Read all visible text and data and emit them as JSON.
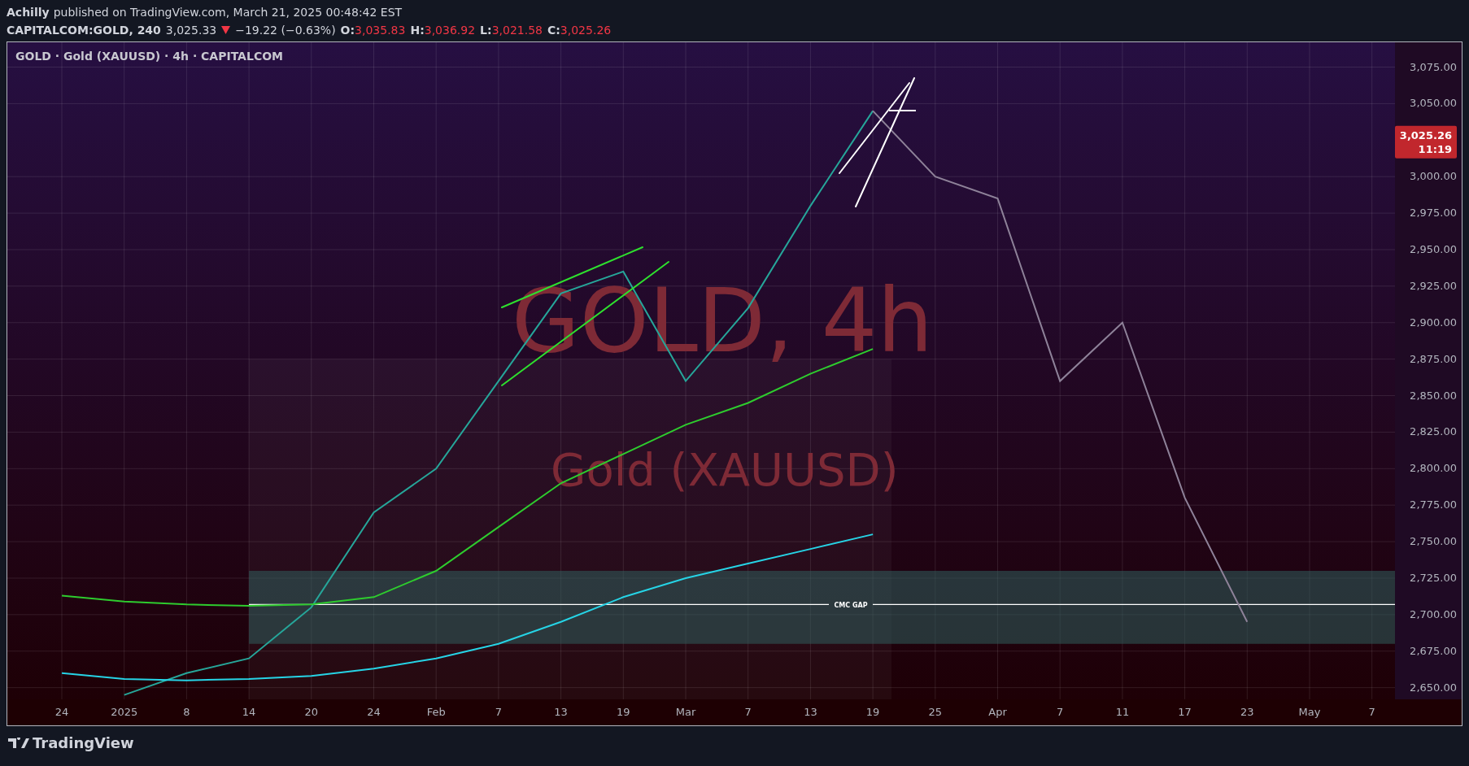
{
  "publisher": {
    "author": "Achilly",
    "text": "published on TradingView.com, March 21, 2025 00:48:42 EST"
  },
  "quote": {
    "symbol": "CAPITALCOM:GOLD, 240",
    "last": "3,025.33",
    "falling": true,
    "change": "−19.22 (−0.63%)",
    "ohlc": [
      {
        "label": "O:",
        "value": "3,035.83"
      },
      {
        "label": "H:",
        "value": "3,036.92"
      },
      {
        "label": "L:",
        "value": "3,021.58"
      },
      {
        "label": "C:",
        "value": "3,025.26"
      }
    ]
  },
  "chart": {
    "legend": "GOLD · Gold (XAUUSD) · 4h · CAPITALCOM",
    "watermark_title": "GOLD, 4h",
    "watermark_subtitle": "Gold (XAUUSD)",
    "price_label": {
      "price": "3,025.26",
      "countdown": "11:19"
    },
    "chart_data": {
      "type": "line",
      "categories": [
        "24",
        "2025",
        "8",
        "14",
        "20",
        "24",
        "Feb",
        "7",
        "13",
        "19",
        "Mar",
        "7",
        "13",
        "19",
        "25",
        "Apr",
        "7",
        "11",
        "17",
        "23",
        "May",
        "7"
      ],
      "ylim": [
        2642,
        3092
      ],
      "grid": true,
      "yticks": [
        {
          "value": 2650,
          "label": "2,650.00"
        },
        {
          "value": 2675,
          "label": "2,675.00"
        },
        {
          "value": 2700,
          "label": "2,700.00"
        },
        {
          "value": 2725,
          "label": "2,725.00"
        },
        {
          "value": 2750,
          "label": "2,750.00"
        },
        {
          "value": 2775,
          "label": "2,775.00"
        },
        {
          "value": 2800,
          "label": "2,800.00"
        },
        {
          "value": 2825,
          "label": "2,825.00"
        },
        {
          "value": 2850,
          "label": "2,850.00"
        },
        {
          "value": 2875,
          "label": "2,875.00"
        },
        {
          "value": 2900,
          "label": "2,900.00"
        },
        {
          "value": 2925,
          "label": "2,925.00"
        },
        {
          "value": 2950,
          "label": "2,950.00"
        },
        {
          "value": 2975,
          "label": "2,975.00"
        },
        {
          "value": 3000,
          "label": "3,000.00"
        },
        {
          "value": 3050,
          "label": "3,050.00"
        },
        {
          "value": 3075,
          "label": "3,075.00"
        }
      ],
      "series": [
        {
          "color": "#26a69a",
          "values": [
            null,
            2645,
            2660,
            2670,
            2705,
            2770,
            2800,
            2860,
            2920,
            2935,
            2860,
            2910,
            2980,
            3045,
            null,
            null,
            null,
            null,
            null,
            null,
            null,
            null
          ]
        },
        {
          "color": "#8e8299",
          "values": [
            null,
            null,
            null,
            null,
            null,
            null,
            null,
            null,
            null,
            null,
            null,
            null,
            null,
            3045,
            3000,
            2985,
            2860,
            2900,
            2780,
            2695,
            null,
            null
          ]
        },
        {
          "color": "#2ecc2e",
          "values": [
            2713,
            2709,
            2707,
            2706,
            2707,
            2712,
            2730,
            2760,
            2790,
            2810,
            2830,
            2845,
            2865,
            2882,
            null,
            null,
            null,
            null,
            null,
            null,
            null,
            null
          ]
        },
        {
          "color": "#26d4e6",
          "values": [
            2660,
            2656,
            2655,
            2656,
            2658,
            2663,
            2670,
            2680,
            2695,
            2712,
            2725,
            2735,
            2745,
            2755,
            null,
            null,
            null,
            null,
            null,
            null,
            null,
            null
          ]
        }
      ],
      "bands": [
        {
          "axis": "y",
          "from": 2680,
          "to": 2730
        }
      ],
      "ref_lines": [
        {
          "axis": "y",
          "value": 2707,
          "label": "CMC GAP"
        }
      ]
    }
  },
  "footer": {
    "brand": "TradingView"
  }
}
